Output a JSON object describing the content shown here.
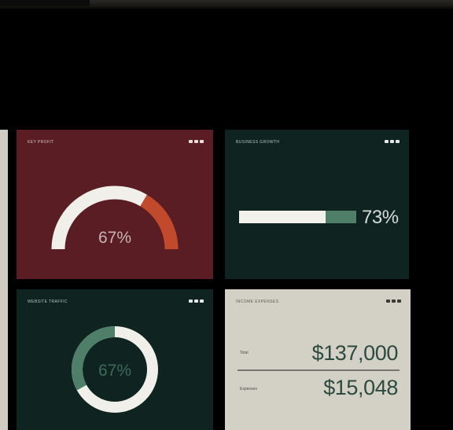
{
  "colors": {
    "kpi_bg": "#5a1d24",
    "kpi_arc_light": "#f1efea",
    "kpi_arc_accent": "#c24a2c",
    "dark_green_bg": "#0f2420",
    "green_accent": "#4f7e69",
    "light_panel_bg": "#d3d1c6",
    "money_text": "#2c4a40"
  },
  "cards": {
    "kpi": {
      "title": "KEY PROFIT",
      "value_text": "67%",
      "progress": 0.67,
      "menu_icon": "more-horizontal-icon"
    },
    "growth": {
      "title": "BUSINESS GROWTH",
      "value_text": "73%",
      "progress": 0.73,
      "menu_icon": "more-horizontal-icon"
    },
    "traffic": {
      "title": "WEBSITE TRAFFIC",
      "value_text": "67%",
      "progress": 0.67,
      "menu_icon": "more-horizontal-icon"
    },
    "income": {
      "title": "INCOME EXPENSES",
      "menu_icon": "more-horizontal-icon",
      "rows": [
        {
          "label": "Total",
          "value": "$137,000"
        },
        {
          "label": "Expenses",
          "value": "$15,048"
        }
      ]
    }
  }
}
